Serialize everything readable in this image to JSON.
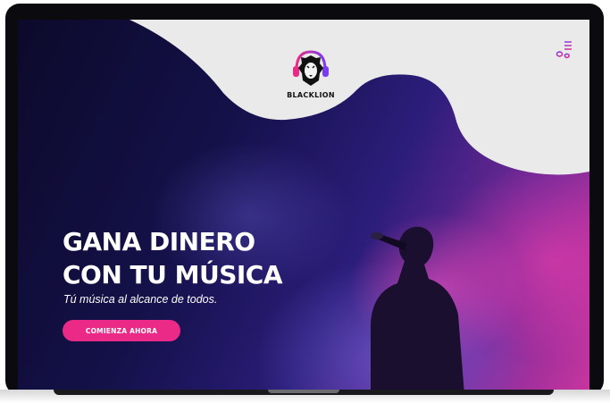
{
  "brand": {
    "name": "BLACKLION",
    "logo_icon": "lion-headphones-icon"
  },
  "header": {
    "music_icon": "music-note-list-icon"
  },
  "hero": {
    "title_line1": "GANA DINERO",
    "title_line2": "CON TU MÚSICA",
    "subtitle": "Tú música al alcance de todos.",
    "cta_label": "COMIENZA AHORA"
  },
  "colors": {
    "accent": "#ea2a86",
    "wave": "#eaeaea",
    "bg_dark": "#0c0a2a",
    "bg_purple": "#2b1d7a",
    "bg_magenta": "#c8359e"
  }
}
